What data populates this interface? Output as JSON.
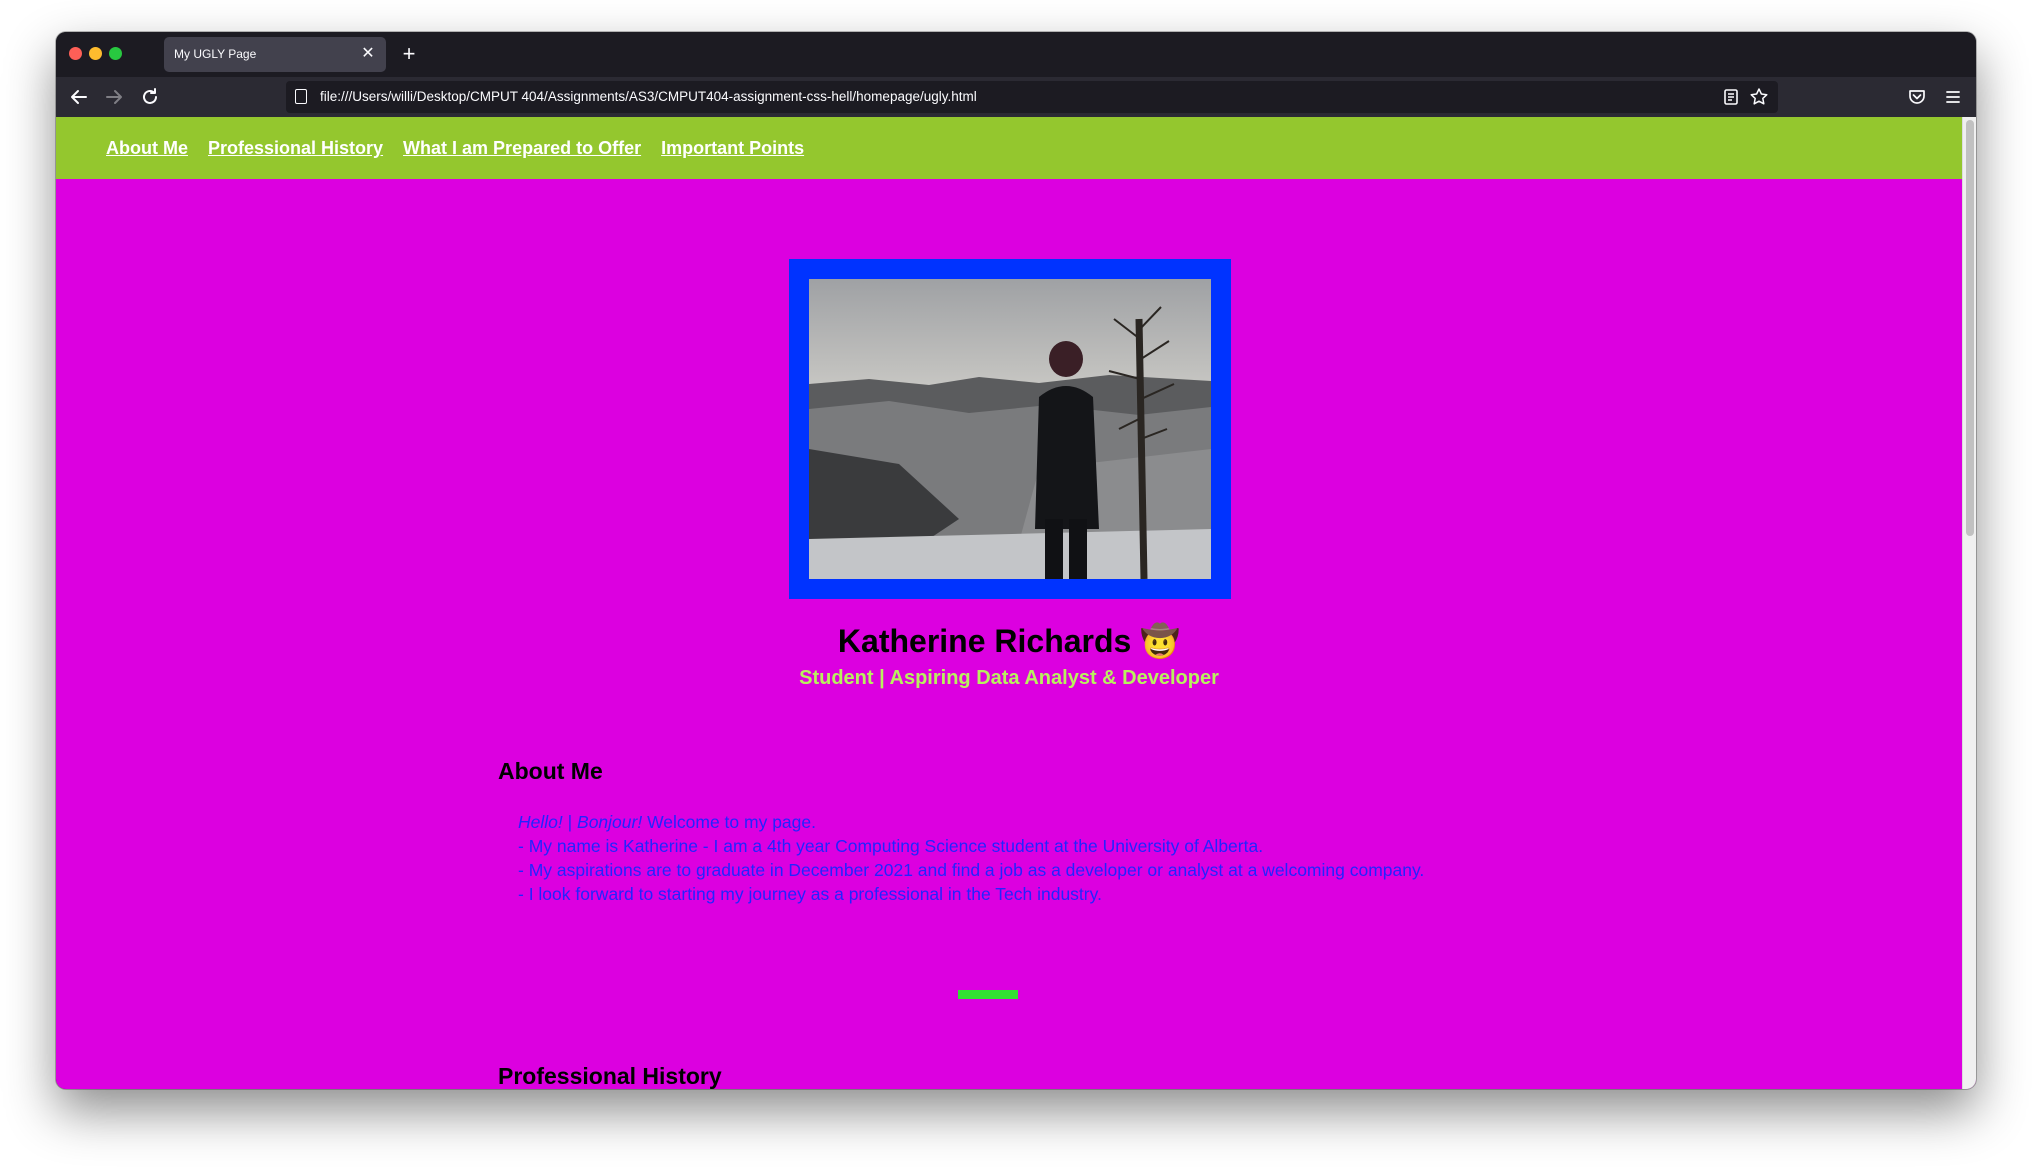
{
  "browser": {
    "tab_title": "My UGLY Page",
    "tab_close": "✕",
    "new_tab": "+",
    "url": "file:///Users/willi/Desktop/CMPUT 404/Assignments/AS3/CMPUT404-assignment-css-hell/homepage/ugly.html",
    "icons": {
      "back": "back-arrow-icon",
      "forward": "forward-arrow-icon",
      "reload": "reload-icon",
      "page": "page-icon",
      "reader": "reader-view-icon",
      "bookmark": "star-icon",
      "pocket": "pocket-icon",
      "menu": "hamburger-menu-icon"
    }
  },
  "nav": {
    "links": [
      "About Me",
      "Professional History",
      "What I am Prepared to Offer",
      "Important Points"
    ]
  },
  "profile": {
    "name": "Katherine Richards",
    "emoji": "🤠",
    "tagline": "Student | Aspiring Data Analyst & Developer"
  },
  "about": {
    "heading": "About Me",
    "greeting_hello": "Hello!",
    "greeting_sep": " | ",
    "greeting_bonjour": "Bonjour!",
    "greeting_rest": " Welcome to my page.",
    "lines": [
      "- My name is Katherine - I am a 4th year Computing Science student at the University of Alberta.",
      "- My aspirations are to graduate in December 2021 and find a job as a developer or analyst at a welcoming company.",
      "- I look forward to starting my journey as a professional in the Tech industry."
    ]
  },
  "history": {
    "heading": "Professional History"
  },
  "colors": {
    "page_background": "#dc00e0",
    "navbar": "#94c72e",
    "photo_border": "#0033ff",
    "tagline": "#b9f05f",
    "about_text": "#2323ff",
    "divider": "#33e133"
  }
}
